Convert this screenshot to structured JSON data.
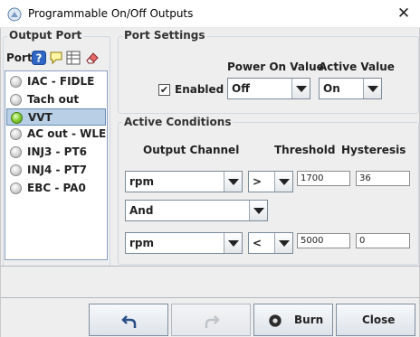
{
  "window": {
    "title": "Programmable On/Off Outputs",
    "close_glyph": "✕"
  },
  "output_port": {
    "group_title": "Output Port",
    "toolbar_label": "Port",
    "toolbar_icons": [
      "help-icon",
      "comment-icon",
      "table-icon",
      "eraser-icon"
    ],
    "items": [
      {
        "label": "IAC - FIDLE",
        "active": false,
        "selected": false
      },
      {
        "label": "Tach out",
        "active": false,
        "selected": false
      },
      {
        "label": "VVT",
        "active": true,
        "selected": true
      },
      {
        "label": "AC out - WLE...",
        "active": false,
        "selected": false
      },
      {
        "label": "INJ3 - PT6",
        "active": false,
        "selected": false
      },
      {
        "label": "INJ4 - PT7",
        "active": false,
        "selected": false
      },
      {
        "label": "EBC - PA0",
        "active": false,
        "selected": false
      }
    ]
  },
  "port_settings": {
    "group_title": "Port Settings",
    "power_on_label": "Power On Value",
    "active_value_label": "Active Value",
    "enabled_label": "Enabled",
    "enabled_checked": true,
    "check_glyph": "✔",
    "power_on_value": "Off",
    "active_value": "On"
  },
  "active_conditions": {
    "group_title": "Active Conditions",
    "output_channel_label": "Output Channel",
    "threshold_label": "Threshold",
    "hysteresis_label": "Hysteresis",
    "row1": {
      "channel": "rpm",
      "operator": ">",
      "threshold": "1700",
      "hysteresis": "36"
    },
    "logic": "And",
    "row2": {
      "channel": "rpm",
      "operator": "<",
      "threshold": "5000",
      "hysteresis": "0"
    }
  },
  "buttons": {
    "undo_icon": "undo-icon",
    "redo_icon": "redo-icon",
    "burn_label": "Burn",
    "close_label": "Close"
  }
}
